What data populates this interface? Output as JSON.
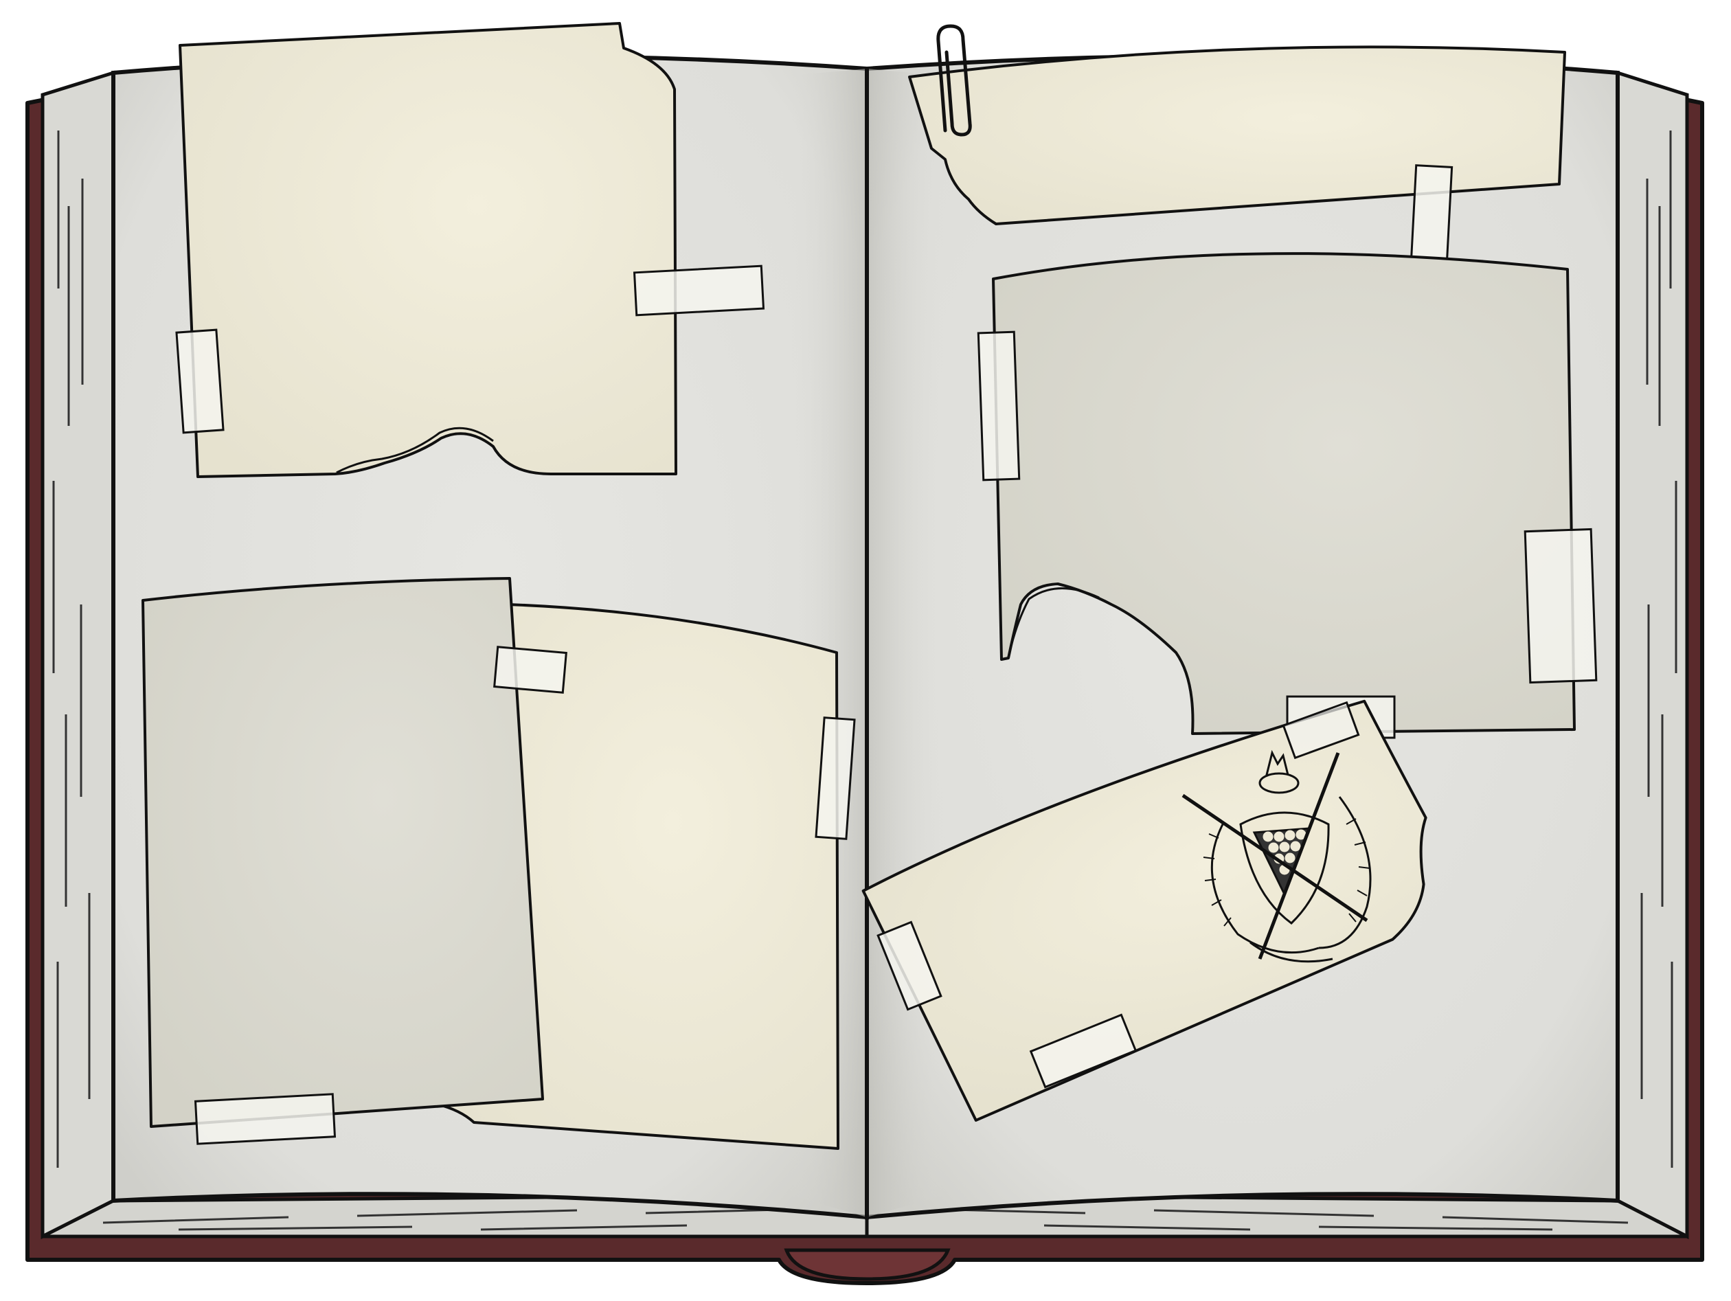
{
  "scene": {
    "kind": "open scrapbook illustration",
    "left_page": {
      "papers": [
        {
          "id": "paper-top-left",
          "tone": "cream",
          "edge": "torn-bottom"
        },
        {
          "id": "paper-bottom-left-back",
          "tone": "cream",
          "edge": "straight"
        },
        {
          "id": "paper-bottom-left-front",
          "tone": "grey",
          "edge": "straight"
        }
      ],
      "tapes": 5
    },
    "right_page": {
      "papers": [
        {
          "id": "paper-top-strip",
          "tone": "cream",
          "edge": "torn-left",
          "fastener": "paperclip"
        },
        {
          "id": "paper-middle-right",
          "tone": "grey",
          "edge": "torn-bottom-left"
        },
        {
          "id": "paper-crest-card",
          "tone": "cream",
          "edge": "torn-right",
          "emblem": "billiards-crest-icon"
        }
      ],
      "tapes": 6
    },
    "colors": {
      "cover": "#5a2a2c",
      "page": "#e1e1dd",
      "cream_paper": "#efead6",
      "grey_paper": "#dcdbd1",
      "tape": "#f4f4ef",
      "ink": "#111111"
    }
  }
}
